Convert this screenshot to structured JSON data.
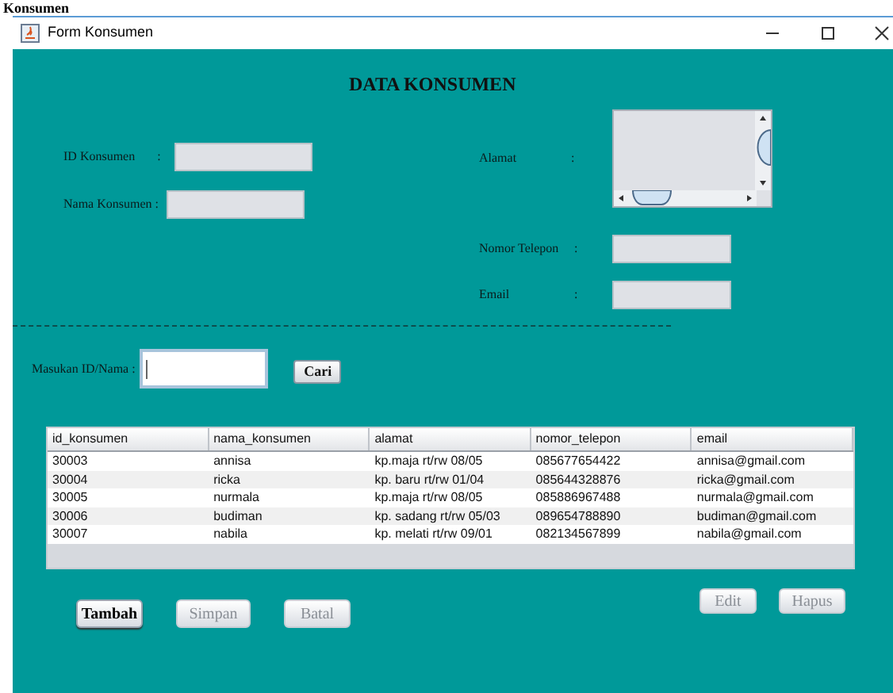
{
  "background_heading": "Konsumen",
  "window": {
    "title": "Form Konsumen"
  },
  "form": {
    "heading": "DATA KONSUMEN",
    "left_fields": [
      {
        "label": "ID Konsumen",
        "colon": ":"
      },
      {
        "label": "Nama Konsumen",
        "colon": ":"
      }
    ],
    "address": {
      "label": "Alamat",
      "colon": ":"
    },
    "right_fields": [
      {
        "label": "Nomor Telepon",
        "colon": ":"
      },
      {
        "label": "Email",
        "colon": ":"
      }
    ]
  },
  "search": {
    "label": "Masukan ID/Nama :",
    "button": "Cari"
  },
  "table": {
    "columns": [
      "id_konsumen",
      "nama_konsumen",
      "alamat",
      "nomor_telepon",
      "email"
    ],
    "rows": [
      [
        "30003",
        "annisa",
        "kp.maja rt/rw 08/05",
        "085677654422",
        "annisa@gmail.com"
      ],
      [
        "30004",
        "ricka",
        "kp. baru rt/rw 01/04",
        "085644328876",
        "ricka@gmail.com"
      ],
      [
        "30005",
        "nurmala",
        "kp.maja rt/rw 08/05",
        "085886967488",
        "nurmala@gmail.com"
      ],
      [
        "30006",
        "budiman",
        "kp. sadang rt/rw 05/03",
        "089654788890",
        "budiman@gmail.com"
      ],
      [
        "30007",
        "nabila",
        "kp. melati rt/rw 09/01",
        "082134567899",
        "nabila@gmail.com"
      ]
    ]
  },
  "left_buttons": [
    {
      "label": "Tambah",
      "disabled": false
    },
    {
      "label": "Simpan",
      "disabled": true
    },
    {
      "label": "Batal",
      "disabled": true
    }
  ],
  "right_buttons": [
    {
      "label": "Edit",
      "disabled": true
    },
    {
      "label": "Hapus",
      "disabled": true
    }
  ]
}
